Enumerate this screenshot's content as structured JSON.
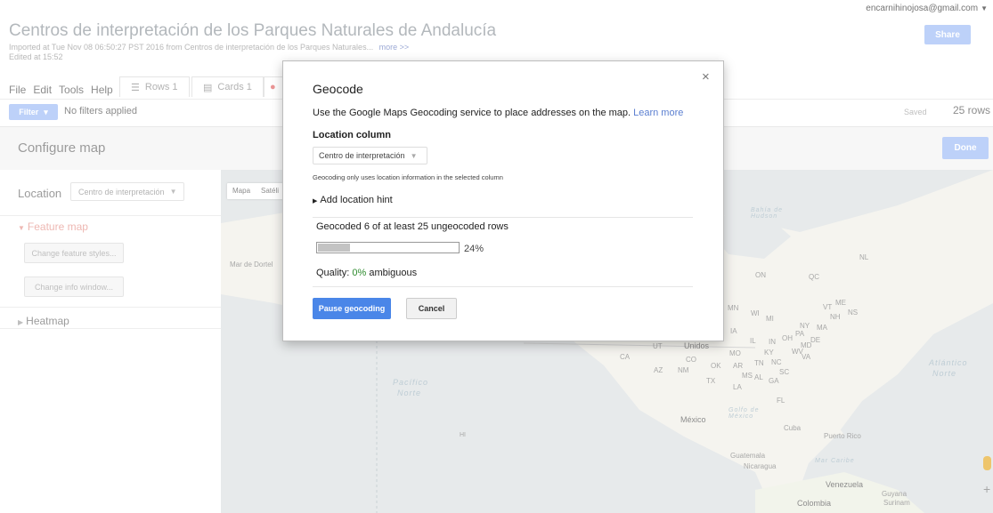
{
  "header": {
    "title": "Centros de interpretación de los Parques Naturales de Andalucía",
    "imported": "Imported at Tue Nov 08 06:50:27 PST 2016 from Centros de interpretación de los Parques Naturales...",
    "more": "more >>",
    "edited": "Edited at 15:52",
    "account": "encarnihinojosa@gmail.com",
    "share_label": "Share"
  },
  "menu": [
    "File",
    "Edit",
    "Tools",
    "Help"
  ],
  "tabs": {
    "rows": "Rows 1",
    "cards": "Cards 1"
  },
  "filterbar": {
    "filter_label": "Filter",
    "no_filters": "No filters applied",
    "saved": "Saved",
    "row_count": "25 rows"
  },
  "configure": {
    "title": "Configure map",
    "done_label": "Done"
  },
  "left_panel": {
    "location_label": "Location",
    "location_value": "Centro de interpretación",
    "feature_map": "Feature map",
    "change_styles": "Change feature styles...",
    "change_info": "Change info window...",
    "heatmap": "Heatmap"
  },
  "map": {
    "type_controls": [
      "Mapa",
      "Satéli"
    ],
    "labels": {
      "bahia": "Bahía de Hudson",
      "mar_de_dortel": "Mar de Dortel",
      "pacifico": "Pacífico",
      "norte": "Norte",
      "atlantico": "Atlántico",
      "norte2": "Norte",
      "mexico": "México",
      "unidos": "Unidos",
      "golfo": "Golfo de México",
      "cuba": "Cuba",
      "puerto_rico": "Puerto Rico",
      "guatemala": "Guatemala",
      "mar_caribe": "Mar Caribe",
      "nicaragua": "Nicaragua",
      "venezuela": "Venezuela",
      "guyana": "Guyana",
      "surinam": "Surinam",
      "colombia": "Colombia",
      "hi": "HI"
    },
    "state_labels": [
      "ON",
      "QC",
      "NL",
      "MN",
      "WI",
      "MI",
      "NY",
      "VT",
      "NH",
      "ME",
      "NS",
      "IA",
      "IN",
      "OH",
      "PA",
      "MA",
      "IL",
      "MD",
      "KY",
      "WV",
      "VA",
      "UT",
      "CA",
      "CO",
      "MO",
      "AZ",
      "NM",
      "OK",
      "AR",
      "TN",
      "NC",
      "MS",
      "AL",
      "GA",
      "SC",
      "TX",
      "LA",
      "FL",
      "DE"
    ]
  },
  "dialog": {
    "title": "Geocode",
    "close": "×",
    "description": "Use the Google Maps Geocoding service to place addresses on the map.",
    "learn_more": "Learn more",
    "location_column_label": "Location column",
    "location_column_value": "Centro de interpretación",
    "only_uses": "Geocoding only uses location information in the selected column",
    "add_hint": "Add location hint",
    "geocoded_status": "Geocoded 6 of at least 25 ungeocoded rows",
    "progress": 0.24,
    "progress_label": "24%",
    "quality_label": "Quality:",
    "quality_value": "0%",
    "quality_suffix": "ambiguous",
    "pause_label": "Pause geocoding",
    "cancel_label": "Cancel"
  },
  "colors": {
    "accent_blue": "#4a86e8",
    "disabled_blue": "#a7c2f7",
    "feature_map_red": "#e9a19a",
    "quality_green": "#2e8b2e"
  }
}
